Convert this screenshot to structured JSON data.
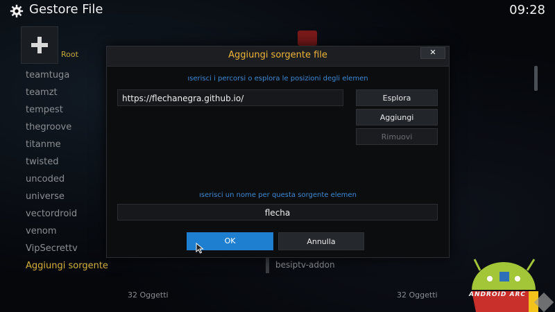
{
  "header": {
    "title": "Gestore File",
    "clock": "09:28",
    "gear_icon": "gear-icon"
  },
  "left_panel": {
    "root_label": "Root",
    "items": [
      "teamtuga",
      "teamzt",
      "tempest",
      "thegroove",
      "titanme",
      "twisted",
      "uncoded",
      "universe",
      "vectordroid",
      "venom",
      "VipSecrettv",
      "Aggiungi sorgente"
    ],
    "count": "32 Oggetti"
  },
  "right_panel": {
    "visible_item": "besiptv-addon",
    "count": "32 Oggetti"
  },
  "dialog": {
    "title": "Aggiungi sorgente file",
    "close_label": "✕",
    "path_hint": "ıserisci i percorsi o esplora le posizioni degli elemen",
    "path_value": "https://flechanegra.github.io/",
    "browse_label": "Esplora",
    "add_label": "Aggiungi",
    "remove_label": "Rimuovi",
    "name_hint": "ıserisci un nome per questa sorgente elemen",
    "name_value": "flecha",
    "ok_label": "OK",
    "cancel_label": "Annulla"
  },
  "watermark": {
    "text": "ANDROID ARC"
  },
  "colors": {
    "accent_blue": "#1e7fd0",
    "title_orange": "#f0b63a",
    "hint_blue": "#3c8ad6",
    "active_gold": "#d6b23f"
  }
}
